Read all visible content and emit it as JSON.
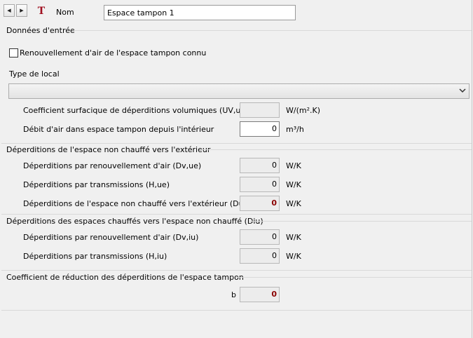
{
  "header": {
    "prev_arrow": "◀",
    "next_arrow": "▶",
    "type_icon": "T",
    "name_label": "Nom",
    "name_value": "Espace tampon 1"
  },
  "input_section": {
    "title": "Données d'entrée",
    "checkbox_label": "Renouvellement d'air de l'espace tampon connu",
    "checkbox_checked": false,
    "local_type_label": "Type de local",
    "local_type_value": "",
    "coef_label": "Coefficient surfacique de déperditions volumiques (UV,ue)",
    "coef_value": "",
    "coef_unit": "W/(m².K)",
    "airflow_label": "Débit d'air dans espace tampon depuis l'intérieur",
    "airflow_value": "0",
    "airflow_unit": "m³/h"
  },
  "unheated_section": {
    "title": "Déperditions de l'espace non chauffé vers l'extérieur",
    "rows": [
      {
        "label": "Déperditions par renouvellement d'air (Dv,ue)",
        "value": "0",
        "unit": "W/K"
      },
      {
        "label": "Déperditions par transmissions  (H,ue)",
        "value": "0",
        "unit": "W/K"
      },
      {
        "label": "Déperditions de l'espace non chauffé vers l'extérieur (Due)",
        "value": "0",
        "unit": "W/K"
      }
    ]
  },
  "heated_section": {
    "title": "Déperditions des espaces chauffés vers l'espace non chauffé (Diu)",
    "rows": [
      {
        "label": "Déperditions par renouvellement d'air (Dv,iu)",
        "value": "0",
        "unit": "W/K"
      },
      {
        "label": "Déperditions par transmissions (H,iu)",
        "value": "0",
        "unit": "W/K"
      }
    ]
  },
  "reduction_section": {
    "title": "Coefficient de réduction des déperditions de l'espace tampon",
    "b_label": "b",
    "b_value": "0"
  },
  "colors": {
    "background": "#f0f0f0",
    "accent_red": "#8b0000",
    "icon_red": "#a01020"
  }
}
